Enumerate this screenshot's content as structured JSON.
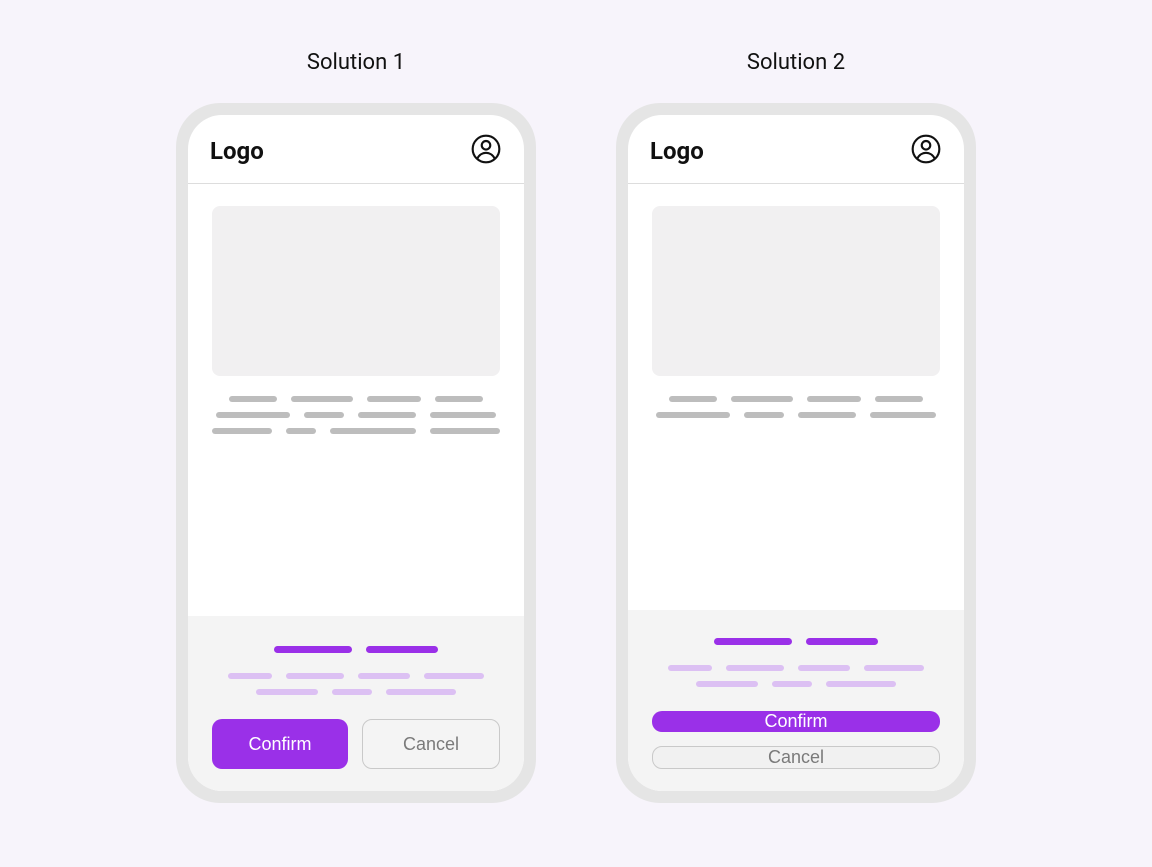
{
  "colors": {
    "accent": "#9a30e8",
    "accent_light": "#dcc0f3",
    "placeholder": "#bdbdbd",
    "panel": "#f4f4f4",
    "page_bg": "#f7f4fb"
  },
  "solutions": [
    {
      "title": "Solution 1",
      "logo": "Logo",
      "confirm_label": "Confirm",
      "cancel_label": "Cancel",
      "button_layout": "row"
    },
    {
      "title": "Solution 2",
      "logo": "Logo",
      "confirm_label": "Confirm",
      "cancel_label": "Cancel",
      "button_layout": "column"
    }
  ]
}
